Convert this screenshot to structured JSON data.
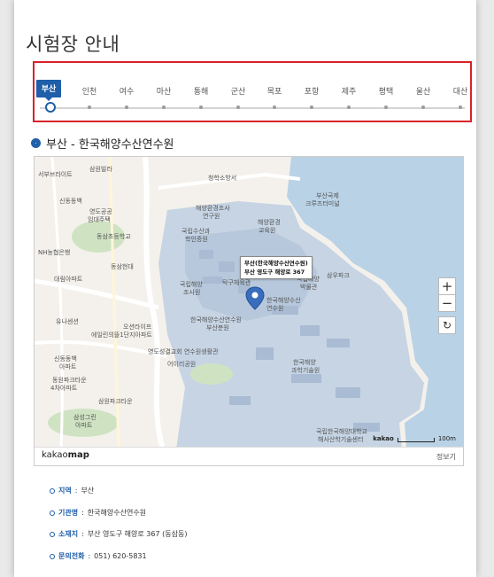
{
  "page": {
    "title": "시험장 안내"
  },
  "tabs": [
    {
      "label": "부산",
      "active": true
    },
    {
      "label": "인천"
    },
    {
      "label": "여수"
    },
    {
      "label": "마산"
    },
    {
      "label": "통해"
    },
    {
      "label": "군산"
    },
    {
      "label": "목포"
    },
    {
      "label": "포항"
    },
    {
      "label": "제주"
    },
    {
      "label": "평택"
    },
    {
      "label": "울산"
    },
    {
      "label": "대산"
    }
  ],
  "location": {
    "heading": "부산 - 한국해양수산연수원"
  },
  "map": {
    "popup_line1": "부산(한국해양수산연수원)",
    "popup_line2": "부산 영도구 해양로 367",
    "zoom_in": "+",
    "zoom_out": "−",
    "refresh": "↻",
    "scale_label": "kakao",
    "scale_value": "100m",
    "logo_main": "kakao",
    "logo_sub": "map",
    "link_label": "정보기",
    "labels": [
      "서부브라이트",
      "삼원빌라",
      "청학소방서",
      "부산국제",
      "크루즈터미널",
      "해양환경조사",
      "연구원",
      "해양환경",
      "교육원",
      "국립수산과",
      "학인증원",
      "영도공공",
      "임대주택",
      "동삼초등학교",
      "신동동백",
      "NH농협은행",
      "동삼현대",
      "대림아파트",
      "국립해양",
      "조사원",
      "탁구체육관",
      "국립해양",
      "박물관",
      "한국해양수산",
      "연수원",
      "삼우파크",
      "오션라이프",
      "에일린의뜰1단지아파트",
      "유나센션",
      "한국해양수산연수원",
      "부산분원",
      "신동동백",
      "아파트",
      "영도성결교회 연수원생활관",
      "어이리공원",
      "한국해양",
      "과학기술원",
      "동원파크타운",
      "4차아파트",
      "삼원파크타운",
      "삼성그린",
      "아파트",
      "국립한국해양대학교",
      "해사산학기술센터"
    ]
  },
  "info": [
    {
      "key": "지역",
      "value": "부산"
    },
    {
      "key": "기관명",
      "value": "한국해양수산연수원"
    },
    {
      "key": "소재지",
      "value": "부산 영도구 해양로 367 (동삼동)"
    },
    {
      "key": "문의전화",
      "value": "051) 620-5831"
    }
  ],
  "colors": {
    "accent": "#1f5ea8",
    "frame": "#d9222a",
    "sea": "#b9d2e6",
    "land": "#f4f1ec",
    "campus": "#c6d4e4"
  }
}
